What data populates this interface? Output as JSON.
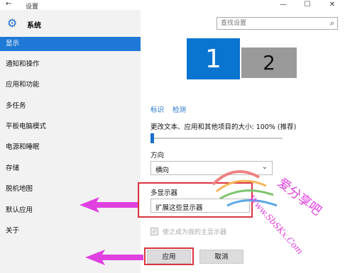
{
  "window": {
    "back_glyph": "←",
    "title": "设置",
    "minimize_glyph": "—",
    "maximize_glyph": "☐",
    "close_glyph": "✕"
  },
  "sidebar": {
    "header_label": "系统",
    "items": [
      {
        "label": "显示",
        "active": true
      },
      {
        "label": "通知和操作"
      },
      {
        "label": "应用和功能"
      },
      {
        "label": "多任务"
      },
      {
        "label": "平板电脑模式"
      },
      {
        "label": "电源和睡眠"
      },
      {
        "label": "存储"
      },
      {
        "label": "脱机地图"
      },
      {
        "label": "默认应用"
      },
      {
        "label": "关于"
      }
    ]
  },
  "search": {
    "placeholder": "查找设置",
    "icon": "search-icon"
  },
  "monitors": {
    "primary": "1",
    "secondary": "2"
  },
  "links": {
    "identify": "标识",
    "detect": "检测"
  },
  "scale": {
    "label": "更改文本、应用和其他项目的大小: 100% (推荐)",
    "value_percent": 0
  },
  "orientation": {
    "label": "方向",
    "value": "横向"
  },
  "multi_display": {
    "label": "多显示器",
    "value": "扩展这些显示器"
  },
  "main_display_checkbox": {
    "label": "使之成为我的主显示器",
    "checked": true
  },
  "buttons": {
    "apply": "应用",
    "cancel": "取消"
  },
  "watermark": {
    "title": "爱分享吧",
    "url": "Www.SbSKx.Com"
  },
  "colors": {
    "accent": "#1e78d6",
    "highlight_box": "#d9353f",
    "arrow": "#e040e0"
  }
}
